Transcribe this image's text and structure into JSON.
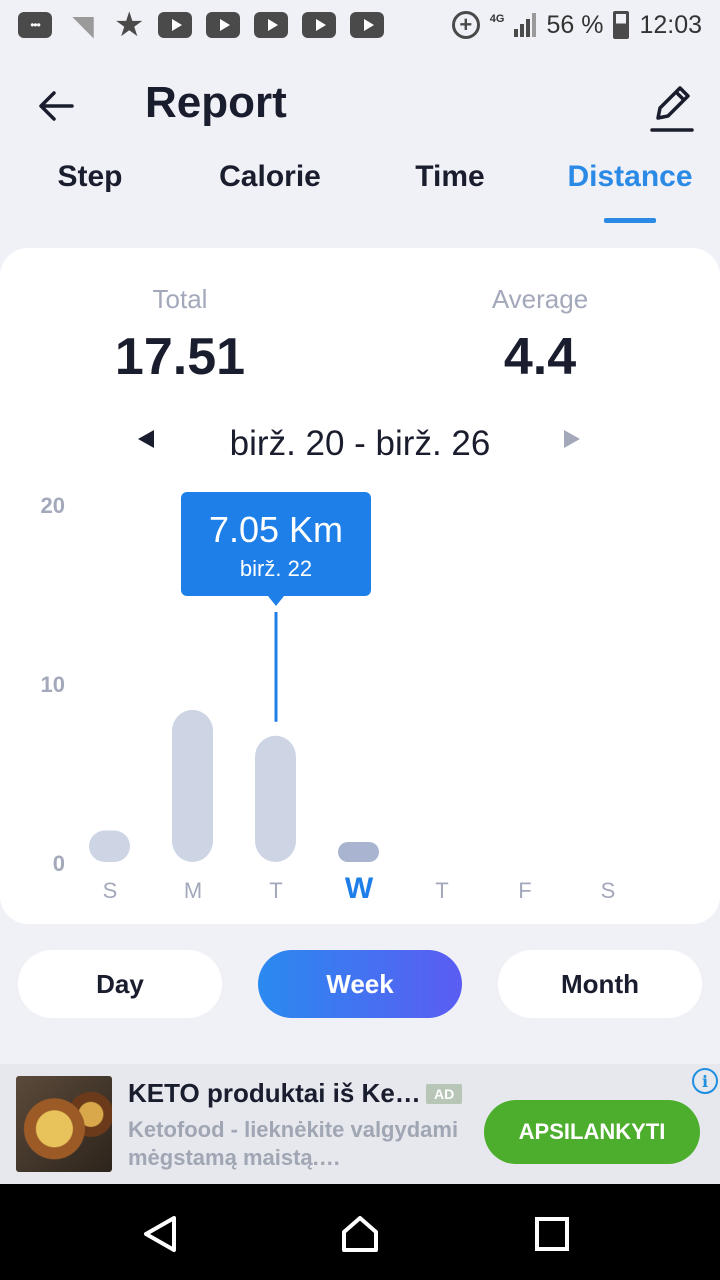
{
  "status_bar": {
    "battery": "56 %",
    "time": "12:03",
    "network": "4G",
    "icons": [
      "messages-icon",
      "wifi-question-icon",
      "star-icon",
      "youtube-icon",
      "youtube-icon",
      "youtube-icon",
      "youtube-icon",
      "youtube-icon",
      "data-saver-icon",
      "signal-icon",
      "battery-icon"
    ]
  },
  "header": {
    "title": "Report",
    "back_icon": "arrow-left-icon",
    "edit_icon": "pencil-icon"
  },
  "tabs": [
    {
      "label": "Step",
      "active": false
    },
    {
      "label": "Calorie",
      "active": false
    },
    {
      "label": "Time",
      "active": false
    },
    {
      "label": "Distance",
      "active": true
    }
  ],
  "summary": {
    "total_label": "Total",
    "total_value": "17.51",
    "average_label": "Average",
    "average_value": "4.4"
  },
  "date_range": "birž. 20 - birž. 26",
  "tooltip": {
    "value": "7.05 Km",
    "date": "birž. 22"
  },
  "chart_data": {
    "type": "bar",
    "categories": [
      "S",
      "M",
      "T",
      "W",
      "T",
      "F",
      "S"
    ],
    "values": [
      1.0,
      8.5,
      7.05,
      0.96,
      0,
      0,
      0
    ],
    "ylim": [
      0,
      20
    ],
    "yticks": [
      0,
      10,
      20
    ],
    "highlighted_category_index": 3,
    "selected_index": 2,
    "grid": false,
    "colors": {
      "bar": "#cdd5e5",
      "bar_current": "#a9b4d0",
      "line": "#1f7fe8",
      "tooltip": "#1f7fe8",
      "axis_text": "#a3a9bb",
      "current_day": "#1f7fe8"
    }
  },
  "period_buttons": [
    {
      "label": "Day",
      "active": false
    },
    {
      "label": "Week",
      "active": true
    },
    {
      "label": "Month",
      "active": false
    }
  ],
  "ad": {
    "title": "KETO produktai iš Ke…",
    "badge": "AD",
    "description": "Ketofood - lieknėkite valgydami mėgstamą maistą.…",
    "cta": "APSILANKYTI",
    "info": "i"
  },
  "navbar": [
    "back-icon",
    "home-icon",
    "recents-icon"
  ]
}
